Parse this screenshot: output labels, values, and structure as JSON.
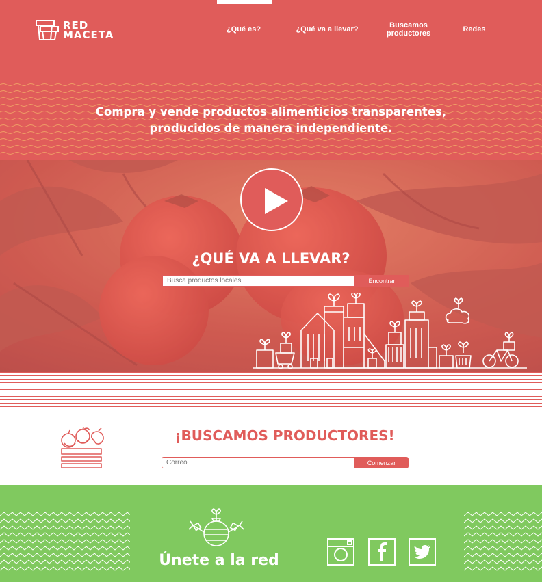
{
  "header": {
    "logo_line1": "RED",
    "logo_line2": "MACETA",
    "nav": [
      {
        "label": "¿Qué es?"
      },
      {
        "label": "¿Qué va a llevar?"
      },
      {
        "label": "Buscamos\nproductores"
      },
      {
        "label": "Redes"
      }
    ]
  },
  "tagline": "Compra y vende productos alimenticios transparentes, producidos de manera independiente.",
  "hero": {
    "title": "¿QUÉ VA A LLEVAR?",
    "search_placeholder": "Busca productos locales",
    "search_button": "Encontrar"
  },
  "producers": {
    "title": "¡BUSCAMOS PRODUCTORES!",
    "email_placeholder": "Correo",
    "submit_button": "Comenzar"
  },
  "footer": {
    "join_title": "Únete a la red",
    "social": [
      "instagram-icon",
      "facebook-icon",
      "twitter-icon"
    ]
  },
  "colors": {
    "brand_red": "#e05c5a",
    "brand_green": "#80c95f",
    "wave_yellow": "#f4b26a"
  }
}
